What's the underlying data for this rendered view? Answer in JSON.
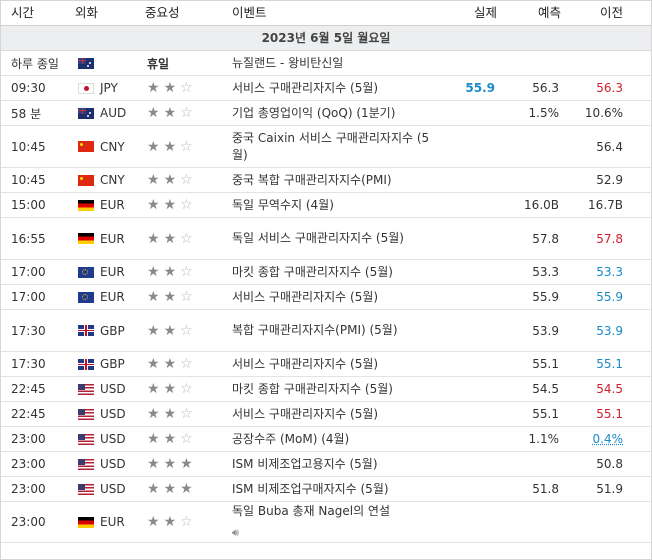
{
  "headers": {
    "time": "시간",
    "currency": "외화",
    "importance": "중요성",
    "event": "이벤트",
    "actual": "실제",
    "forecast": "예측",
    "previous": "이전"
  },
  "date_label": "2023년 6월 5일 월요일",
  "rows": [
    {
      "time": "하루 종일",
      "flag": "nz",
      "currency": "",
      "stars": null,
      "holiday": "휴일",
      "event": "뉴질랜드 - 왕비탄신일",
      "actual": "",
      "forecast": "",
      "previous": "",
      "prev_color": "",
      "act_color": ""
    },
    {
      "time": "09:30",
      "flag": "jp",
      "currency": "JPY",
      "stars": 2,
      "event": "서비스 구매관리자지수 (5월)",
      "actual": "55.9",
      "forecast": "56.3",
      "previous": "56.3",
      "prev_color": "red",
      "act_color": "blue"
    },
    {
      "time": "58 분",
      "flag": "au",
      "currency": "AUD",
      "stars": 2,
      "event": "기업 총영업이익 (QoQ) (1분기)",
      "actual": "",
      "forecast": "1.5%",
      "previous": "10.6%",
      "prev_color": "",
      "act_color": ""
    },
    {
      "time": "10:45",
      "flag": "cn",
      "currency": "CNY",
      "stars": 2,
      "event": "중국 Caixin 서비스 구매관리자지수 (5월)",
      "actual": "",
      "forecast": "",
      "previous": "56.4",
      "prev_color": "",
      "act_color": ""
    },
    {
      "time": "10:45",
      "flag": "cn",
      "currency": "CNY",
      "stars": 2,
      "event": "중국 복합 구매관리자지수(PMI)",
      "actual": "",
      "forecast": "",
      "previous": "52.9",
      "prev_color": "",
      "act_color": ""
    },
    {
      "time": "15:00",
      "flag": "de",
      "currency": "EUR",
      "stars": 2,
      "event": "독일 무역수지 (4월)",
      "actual": "",
      "forecast": "16.0B",
      "previous": "16.7B",
      "prev_color": "",
      "act_color": ""
    },
    {
      "time": "16:55",
      "flag": "de",
      "currency": "EUR",
      "stars": 2,
      "event": "독일 서비스 구매관리자지수 (5월)",
      "actual": "",
      "forecast": "57.8",
      "previous": "57.8",
      "prev_color": "red",
      "act_color": ""
    },
    {
      "time": "17:00",
      "flag": "eu",
      "currency": "EUR",
      "stars": 2,
      "event": "마킷 종합 구매관리자지수 (5월)",
      "actual": "",
      "forecast": "53.3",
      "previous": "53.3",
      "prev_color": "blue",
      "act_color": ""
    },
    {
      "time": "17:00",
      "flag": "eu",
      "currency": "EUR",
      "stars": 2,
      "event": "서비스 구매관리자지수 (5월)",
      "actual": "",
      "forecast": "55.9",
      "previous": "55.9",
      "prev_color": "blue",
      "act_color": ""
    },
    {
      "time": "17:30",
      "flag": "gb",
      "currency": "GBP",
      "stars": 2,
      "event": "복합 구매관리자지수(PMI) (5월)",
      "actual": "",
      "forecast": "53.9",
      "previous": "53.9",
      "prev_color": "blue",
      "act_color": ""
    },
    {
      "time": "17:30",
      "flag": "gb",
      "currency": "GBP",
      "stars": 2,
      "event": "서비스 구매관리자지수 (5월)",
      "actual": "",
      "forecast": "55.1",
      "previous": "55.1",
      "prev_color": "blue",
      "act_color": ""
    },
    {
      "time": "22:45",
      "flag": "us",
      "currency": "USD",
      "stars": 2,
      "event": "마킷 종합 구매관리자지수 (5월)",
      "actual": "",
      "forecast": "54.5",
      "previous": "54.5",
      "prev_color": "red",
      "act_color": ""
    },
    {
      "time": "22:45",
      "flag": "us",
      "currency": "USD",
      "stars": 2,
      "event": "서비스 구매관리자지수 (5월)",
      "actual": "",
      "forecast": "55.1",
      "previous": "55.1",
      "prev_color": "red",
      "act_color": ""
    },
    {
      "time": "23:00",
      "flag": "us",
      "currency": "USD",
      "stars": 2,
      "event": "공장수주 (MoM) (4월)",
      "actual": "",
      "forecast": "1.1%",
      "previous": "0.4%",
      "prev_color": "blue-dotted",
      "act_color": ""
    },
    {
      "time": "23:00",
      "flag": "us",
      "currency": "USD",
      "stars": 3,
      "event": "ISM 비제조업고용지수 (5월)",
      "actual": "",
      "forecast": "",
      "previous": "50.8",
      "prev_color": "",
      "act_color": ""
    },
    {
      "time": "23:00",
      "flag": "us",
      "currency": "USD",
      "stars": 3,
      "event": "ISM 비제조업구매자지수 (5월)",
      "actual": "",
      "forecast": "51.8",
      "previous": "51.9",
      "prev_color": "",
      "act_color": ""
    },
    {
      "time": "23:00",
      "flag": "de",
      "currency": "EUR",
      "stars": 2,
      "event": "독일 Buba 총재 Nagel의 연설",
      "actual": "",
      "forecast": "",
      "previous": "",
      "prev_color": "",
      "act_color": "",
      "speech": true
    }
  ],
  "icons": {
    "speech": "speaker-icon",
    "star": "star-icon"
  }
}
